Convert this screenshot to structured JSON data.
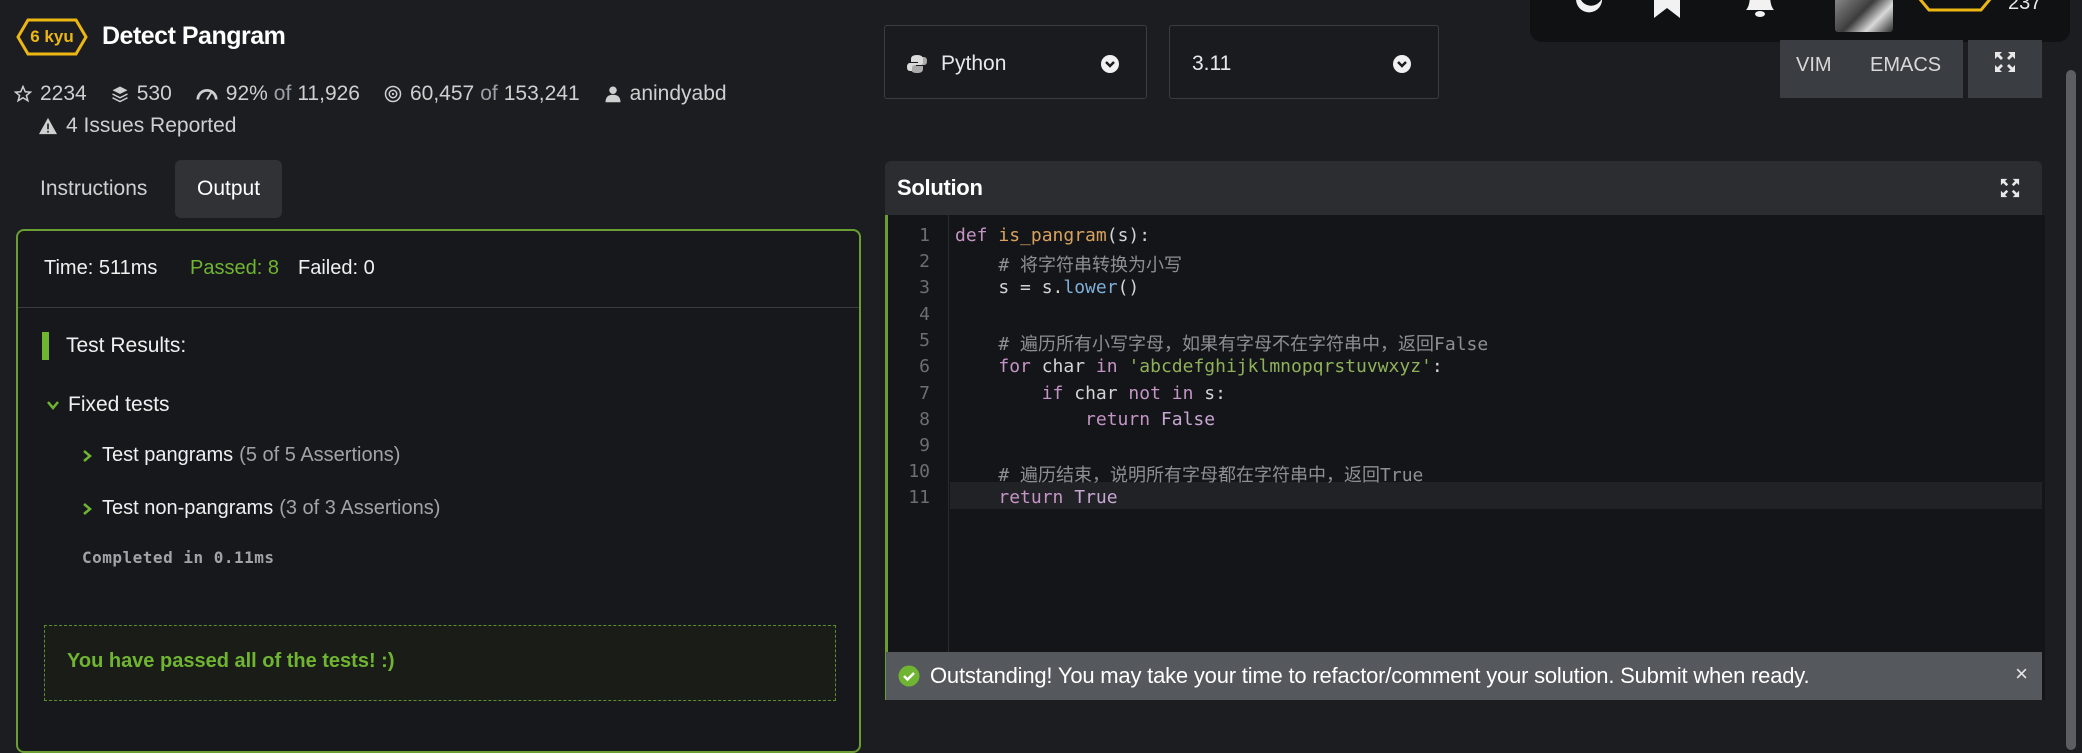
{
  "kata": {
    "rank": "6 kyu",
    "title": "Detect Pangram",
    "stars": "2234",
    "collections": "530",
    "satisfaction_pct": "92%",
    "satisfaction_of": "of",
    "satisfaction_votes": "11,926",
    "completed": "60,457",
    "completed_of": "of",
    "attempted": "153,241",
    "author": "anindyabd",
    "issues": "4 Issues Reported"
  },
  "tabs": {
    "instructions": "Instructions",
    "output": "Output",
    "active": "Output"
  },
  "output": {
    "time": "Time: 511ms",
    "passed": "Passed: 8",
    "failed": "Failed: 0",
    "test_results": "Test Results:",
    "group": "Fixed tests",
    "tests": [
      {
        "name": "Test pangrams",
        "detail": "(5 of 5 Assertions)"
      },
      {
        "name": "Test non-pangrams",
        "detail": "(3 of 3 Assertions)"
      }
    ],
    "completed": "Completed in 0.11ms",
    "success": "You have passed all of the tests! :)"
  },
  "language": {
    "selected": "Python",
    "version": "3.11"
  },
  "editor_modes": {
    "vim": "VIM",
    "emacs": "EMACS"
  },
  "solution": {
    "title": "Solution",
    "line_numbers": [
      "1",
      "2",
      "3",
      "4",
      "5",
      "6",
      "7",
      "8",
      "9",
      "10",
      "11"
    ],
    "lines": [
      "def is_pangram(s):",
      "    # 将字符串转换为小写",
      "    s = s.lower()",
      "",
      "    # 遍历所有小写字母，如果有字母不在字符串中，返回False",
      "    for char in 'abcdefghijklmnopqrstuvwxyz':",
      "        if char not in s:",
      "            return False",
      "",
      "    # 遍历结束，说明所有字母都在字符串中，返回True",
      "    return True"
    ]
  },
  "toast": {
    "message": "Outstanding! You may take your time to refactor/comment your solution. Submit when ready.",
    "close": "×"
  },
  "colors": {
    "accent": "#6fb531",
    "kyu": "#ecb613",
    "background": "#1c1d21"
  }
}
